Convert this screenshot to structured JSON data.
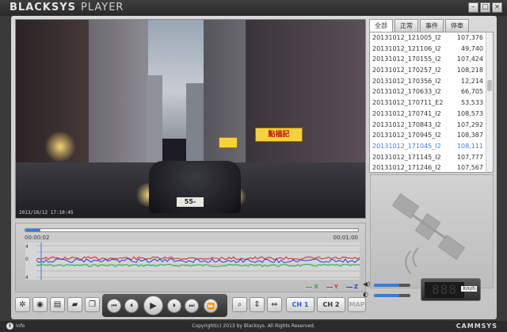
{
  "window": {
    "logo_main": "BLACKSYS",
    "logo_sub": "PLAYER",
    "minimize_glyph": "–",
    "maximize_glyph": "□",
    "close_glyph": "×"
  },
  "video": {
    "timestamp": "2013/10/12 17:10:45",
    "plate_text": "55-8172",
    "sign_text": "點福記"
  },
  "filelist": {
    "tabs": [
      {
        "label": "全部",
        "active": true
      },
      {
        "label": "正常",
        "active": false
      },
      {
        "label": "事件",
        "active": false
      },
      {
        "label": "停車",
        "active": false
      }
    ],
    "rows": [
      {
        "name": "20131012_121005_I2",
        "size": "107,376"
      },
      {
        "name": "20131012_121106_I2",
        "size": "49,740"
      },
      {
        "name": "20131012_170155_I2",
        "size": "107,424"
      },
      {
        "name": "20131012_170257_I2",
        "size": "108,218"
      },
      {
        "name": "20131012_170356_I2",
        "size": "12,214"
      },
      {
        "name": "20131012_170633_I2",
        "size": "66,705"
      },
      {
        "name": "20131012_170711_E2",
        "size": "53,533"
      },
      {
        "name": "20131012_170741_I2",
        "size": "108,573"
      },
      {
        "name": "20131012_170843_I2",
        "size": "107,292"
      },
      {
        "name": "20131012_170945_I2",
        "size": "108,387"
      },
      {
        "name": "20131012_171045_I2",
        "size": "108,111",
        "selected": true
      },
      {
        "name": "20131012_171145_I2",
        "size": "107,777"
      },
      {
        "name": "20131012_171246_I2",
        "size": "107,567"
      }
    ]
  },
  "timeline": {
    "current": "00:00:02",
    "end": "00:01:00",
    "progress": 0.045
  },
  "graph": {
    "tick_top": "4",
    "tick_mid": "0",
    "tick_bottom": "4",
    "legend_x": "X",
    "legend_y": "Y",
    "legend_z": "Z",
    "color_x": "#2ea84a",
    "color_y": "#e03030",
    "color_z": "#2a3ce0"
  },
  "toolbar": {
    "settings_glyph": "✲",
    "snapshot_glyph": "◉",
    "print_glyph": "▤",
    "folder_glyph": "▰",
    "export_glyph": "❐",
    "prev_file_glyph": "⏮",
    "prev_frame_glyph": "⏴",
    "play_glyph": "▶",
    "next_frame_glyph": "⏵",
    "next_file_glyph": "⏭",
    "fastforward_glyph": "⏩",
    "zoom_glyph": "⌕",
    "flip_v_glyph": "⇕",
    "flip_h_glyph": "⇔",
    "ch1_label": "CH 1",
    "ch2_label": "CH 2",
    "map_label": "MAP"
  },
  "sliders": {
    "volume_level": 0.7,
    "brightness_level": 0.7,
    "volume_glyph": "◀)",
    "brightness_glyph": "◐"
  },
  "speed": {
    "value": "888",
    "unit": "Km/h"
  },
  "status": {
    "info_label": "info",
    "copyright": "Copyright(c) 2013 by Blacksys. All Rights Reserved.",
    "brand": "CAMMSYS"
  }
}
